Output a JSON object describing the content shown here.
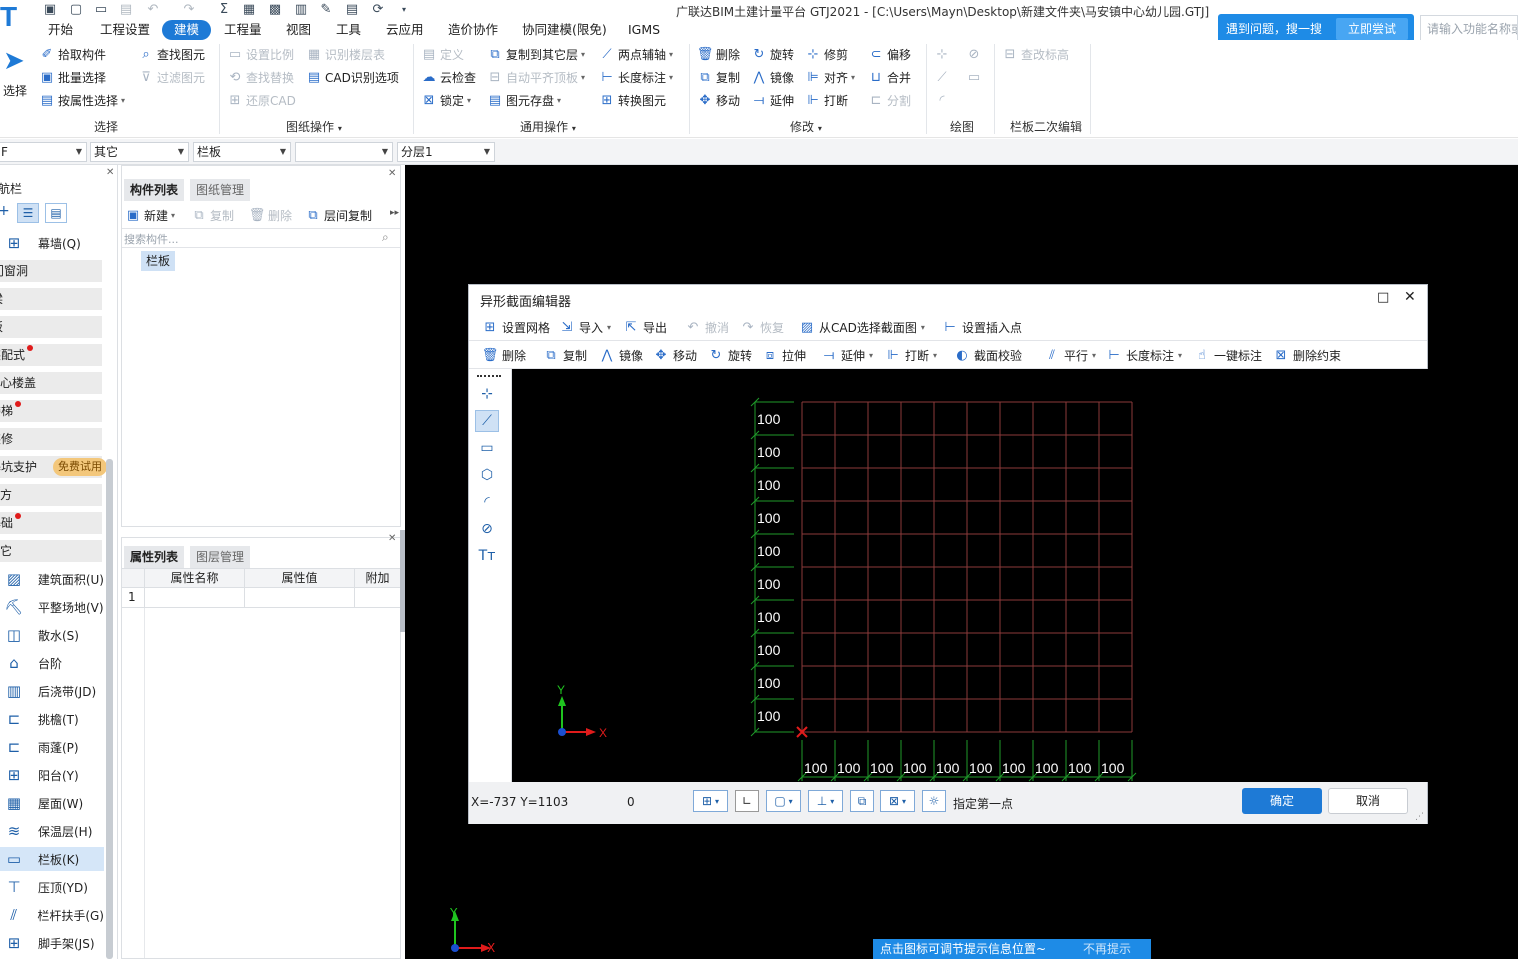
{
  "app": {
    "title": "广联达BIM土建计量平台 GTJ2021 - [C:\\Users\\Mayn\\Desktop\\新建文件夹\\马安镇中心幼儿园.GTJ]",
    "logo_text": "T"
  },
  "help": {
    "text": "遇到问题，搜一搜",
    "button": "立即尝试",
    "search_placeholder": "请输入功能名称或"
  },
  "menu": [
    "开始",
    "工程设置",
    "建模",
    "工程量",
    "视图",
    "工具",
    "云应用",
    "造价协作",
    "协同建模(限免)",
    "IGMS"
  ],
  "menu_active": "建模",
  "ribbon": {
    "select_big": "选择",
    "select_items": [
      "拾取构件",
      "批量选择",
      "按属性选择"
    ],
    "find_items": [
      "查找图元",
      "过滤图元"
    ],
    "drawing_items": [
      "设置比例",
      "识别楼层表",
      "查找替换",
      "CAD识别选项",
      "还原CAD"
    ],
    "general_items": [
      "定义",
      "复制到其它层",
      "两点辅轴",
      "云检查",
      "自动平齐顶板",
      "长度标注",
      "锁定",
      "图元存盘",
      "转换图元"
    ],
    "modify_items": [
      "删除",
      "旋转",
      "修剪",
      "偏移",
      "复制",
      "镜像",
      "对齐",
      "合并",
      "移动",
      "延伸",
      "打断",
      "分割"
    ],
    "railing_items": [
      "查改标高"
    ],
    "groups": [
      "选择",
      "图纸操作",
      "通用操作",
      "修改",
      "绘图",
      "栏板二次编辑"
    ]
  },
  "dropdowns": [
    "F",
    "其它",
    "栏板",
    "",
    "分层1"
  ],
  "nav": {
    "title": "导航栏",
    "sections": [
      {
        "label": "幕墙(Q)",
        "type": "item"
      },
      {
        "label": "门窗洞",
        "type": "sec"
      },
      {
        "label": "梁",
        "type": "sec"
      },
      {
        "label": "板",
        "type": "sec"
      },
      {
        "label": "装配式",
        "type": "sec",
        "dot": true
      },
      {
        "label": "空心楼盖",
        "type": "sec"
      },
      {
        "label": "楼梯",
        "type": "sec",
        "dot": true
      },
      {
        "label": "装修",
        "type": "sec"
      },
      {
        "label": "基坑支护",
        "type": "sec",
        "badge": "免费试用"
      },
      {
        "label": "土方",
        "type": "sec"
      },
      {
        "label": "基础",
        "type": "sec",
        "dot": true
      },
      {
        "label": "其它",
        "type": "sec"
      }
    ],
    "items": [
      "建筑面积(U)",
      "平整场地(V)",
      "散水(S)",
      "台阶",
      "后浇带(JD)",
      "挑檐(T)",
      "雨蓬(P)",
      "阳台(Y)",
      "屋面(W)",
      "保温层(H)",
      "栏板(K)",
      "压顶(YD)",
      "栏杆扶手(G)",
      "脚手架(JS)"
    ],
    "selected": "栏板(K)"
  },
  "component_list": {
    "tabs": [
      "构件列表",
      "图纸管理"
    ],
    "toolbar": [
      "新建",
      "复制",
      "删除",
      "层间复制"
    ],
    "search_placeholder": "搜索构件...",
    "items": [
      "栏板"
    ]
  },
  "property": {
    "tabs": [
      "属性列表",
      "图层管理"
    ],
    "columns": [
      "属性名称",
      "属性值",
      "附加"
    ],
    "rows": [
      "1"
    ]
  },
  "dialog": {
    "title": "异形截面编辑器",
    "toolbar1": [
      "设置网格",
      "导入",
      "导出",
      "撤消",
      "恢复",
      "从CAD选择截面图",
      "设置插入点"
    ],
    "toolbar2": [
      "删除",
      "复制",
      "镜像",
      "移动",
      "旋转",
      "拉伸",
      "延伸",
      "打断",
      "截面校验",
      "平行",
      "长度标注",
      "一键标注",
      "删除约束"
    ],
    "grid": {
      "rows": 10,
      "cols": 10,
      "row_labels": [
        "100",
        "100",
        "100",
        "100",
        "100",
        "100",
        "100",
        "100",
        "100",
        "100"
      ],
      "col_labels": [
        "100",
        "100",
        "100",
        "100",
        "100",
        "100",
        "100",
        "100",
        "100",
        "100"
      ]
    },
    "axis_x": "X",
    "axis_y": "Y",
    "coords": "X=-737 Y=1103",
    "status_value": "0",
    "prompt": "指定第一点",
    "ok": "确定",
    "cancel": "取消"
  },
  "tip": {
    "text": "点击图标可调节提示信息位置~",
    "action": "不再提示"
  },
  "canvas_axis": {
    "x": "X",
    "y": "Y"
  },
  "colors": {
    "accent": "#1e7ad6",
    "grid_line": "#8c3a3a",
    "grid_green": "#1f9a2a"
  }
}
